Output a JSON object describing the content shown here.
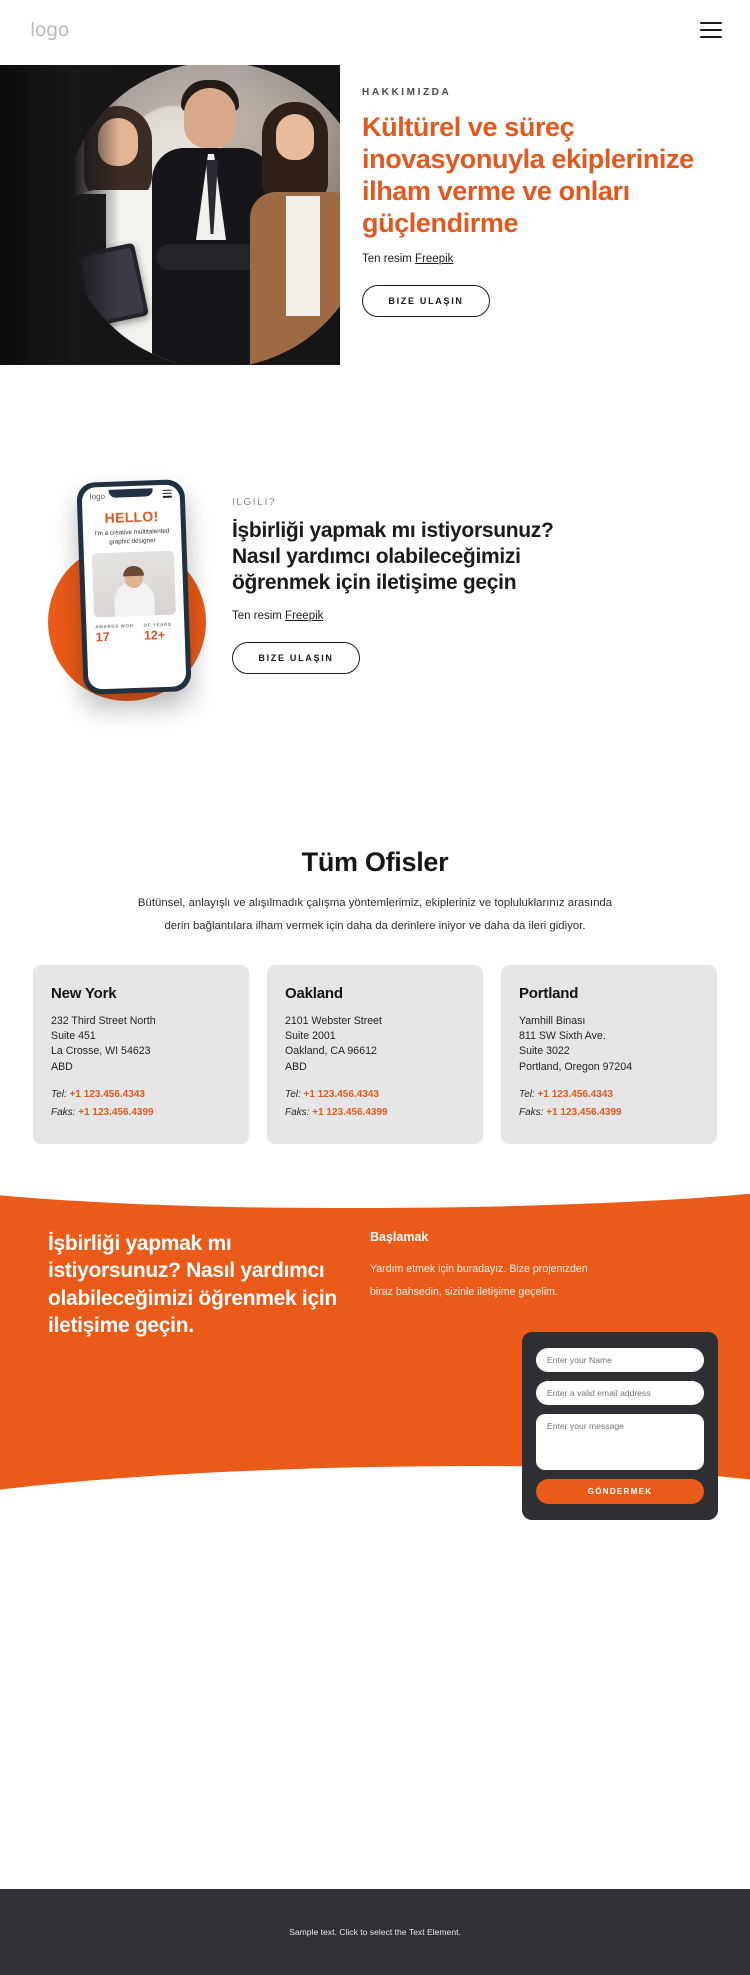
{
  "header": {
    "logo": "logo",
    "menu_icon": "hamburger-menu-icon"
  },
  "hero": {
    "eyebrow": "HAKKIMIZDA",
    "title": "Kültürel ve süreç inovasyonuyla ekiplerinize ilham verme ve onları güçlendirme",
    "credit_prefix": "Ten resim ",
    "credit_link": "Freepik",
    "cta_label": "BIZE ULAŞIN"
  },
  "section2": {
    "eyebrow": "ILGILI?",
    "title": "İşbirliği yapmak mı istiyorsunuz? Nasıl yardımcı olabileceğimizi öğrenmek için iletişime geçin",
    "credit_prefix": "Ten resim ",
    "credit_link": "Freepik",
    "cta_label": "BIZE ULAŞIN",
    "phone": {
      "logo": "logo",
      "hello": "HELLO!",
      "subtitle": "I'm a creative multitalented graphic designer",
      "stats": [
        {
          "label": "AWARDS WON",
          "value": "17"
        },
        {
          "label": "OF YEARS",
          "value": "12+"
        }
      ]
    }
  },
  "offices": {
    "title": "Tüm Ofisler",
    "intro_line1": "Bütünsel, anlayışlı ve alışılmadık çalışma yöntemlerimiz, ekipleriniz ve topluluklarınız arasında",
    "intro_line2": "derin bağlantılara ilham vermek için daha da derinlere iniyor ve daha da ileri gidiyor.",
    "tel_label": "Tel:",
    "fax_label": "Faks:",
    "cards": [
      {
        "city": "New York",
        "address": "232 Third Street North\nSuite 451\nLa Crosse, WI 54623\nABD",
        "tel": "+1 123.456.4343",
        "fax": "+1 123.456.4399"
      },
      {
        "city": "Oakland",
        "address": "2101 Webster Street\nSuite 2001\nOakland, CA 96612\nABD",
        "tel": "+1 123.456.4343",
        "fax": "+1 123.456.4399"
      },
      {
        "city": "Portland",
        "address": "Yamhill Binası\n811 SW Sixth Ave.\nSuite 3022\nPortland, Oregon 97204",
        "tel": "+1 123.456.4343",
        "fax": "+1 123.456.4399"
      }
    ]
  },
  "cta": {
    "headline": "İşbirliği yapmak mı istiyorsunuz? Nasıl yardımcı olabileceğimizi öğrenmek için iletişime geçin.",
    "subtitle": "Başlamak",
    "body": "Yardım etmek için buradayız. Bize projenizden biraz bahsedin, sizinle iletişime geçelim.",
    "form": {
      "name_placeholder": "Enter your Name",
      "email_placeholder": "Enter a valid email address",
      "message_placeholder": "Enter your message",
      "submit_label": "GÖNDERMEK"
    }
  },
  "footer": {
    "text": "Sample text. Click to select the Text Element."
  },
  "colors": {
    "accent_orange": "#ea5b19",
    "hero_orange": "#e2591f",
    "card_grey": "#e6e6e6",
    "footer_dark": "#2f3135",
    "form_dark": "#2d2f33"
  }
}
